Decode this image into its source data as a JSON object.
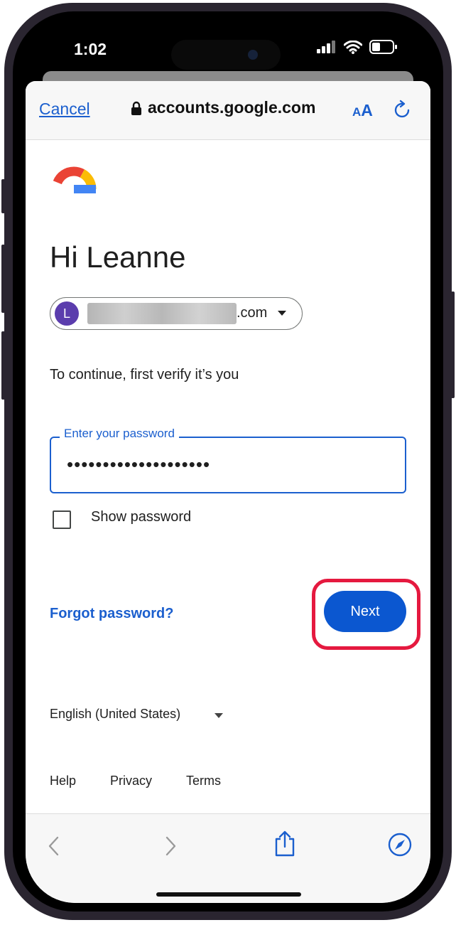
{
  "status_bar": {
    "time": "1:02"
  },
  "browser": {
    "cancel_label": "Cancel",
    "url": "accounts.google.com",
    "aa_small": "A",
    "aa_big": "A"
  },
  "page": {
    "greeting": "Hi Leanne",
    "account": {
      "avatar_letter": "L",
      "email_domain": ".com"
    },
    "verify_text": "To continue, first verify it’s you",
    "password_label": "Enter your password",
    "password_value": "••••••••••••••••••••",
    "show_password_label": "Show password",
    "forgot_label": "Forgot password?",
    "next_label": "Next",
    "language": "English (United States)",
    "footer_links": [
      "Help",
      "Privacy",
      "Terms"
    ]
  },
  "colors": {
    "accent": "#0b57d0",
    "highlight": "#e5193f",
    "avatar": "#5b3dad"
  },
  "icons": [
    "lock-icon",
    "reload-icon",
    "back-icon",
    "forward-icon",
    "share-icon",
    "compass-icon",
    "signal-icon",
    "wifi-icon",
    "battery-icon",
    "google-logo"
  ]
}
